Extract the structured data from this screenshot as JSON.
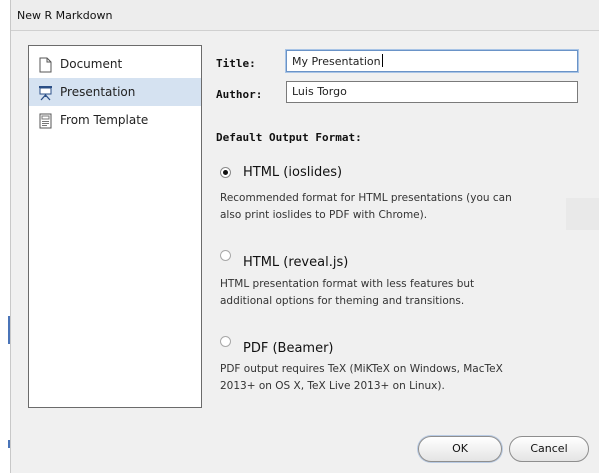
{
  "dialog": {
    "title": "New R Markdown"
  },
  "doc_types": [
    {
      "label": "Document",
      "icon": "document-icon",
      "selected": false
    },
    {
      "label": "Presentation",
      "icon": "presentation-icon",
      "selected": true
    },
    {
      "label": "From Template",
      "icon": "template-icon",
      "selected": false
    }
  ],
  "form": {
    "title_label": "Title:",
    "title_value": "My Presentation",
    "author_label": "Author:",
    "author_value": "Luis Torgo",
    "default_format_label": "Default Output Format:"
  },
  "formats": [
    {
      "label": "HTML (ioslides)",
      "checked": true,
      "description_lines": [
        "Recommended format for HTML presentations (you can",
        "also print ioslides to PDF with Chrome)."
      ]
    },
    {
      "label": "HTML (reveal.js)",
      "checked": false,
      "description_lines": [
        "HTML presentation format with less features but",
        "additional options for theming and transitions."
      ]
    },
    {
      "label": "PDF (Beamer)",
      "checked": false,
      "description_lines": [
        "PDF output requires TeX (MiKTeX on Windows, MacTeX",
        "2013+ on OS X, TeX Live 2013+ on Linux)."
      ]
    }
  ],
  "buttons": {
    "ok": "OK",
    "cancel": "Cancel"
  },
  "colors": {
    "selection": "#d5e2f1",
    "focus_ring": "#6a93c7",
    "edge_accent": "#4a74b8"
  }
}
